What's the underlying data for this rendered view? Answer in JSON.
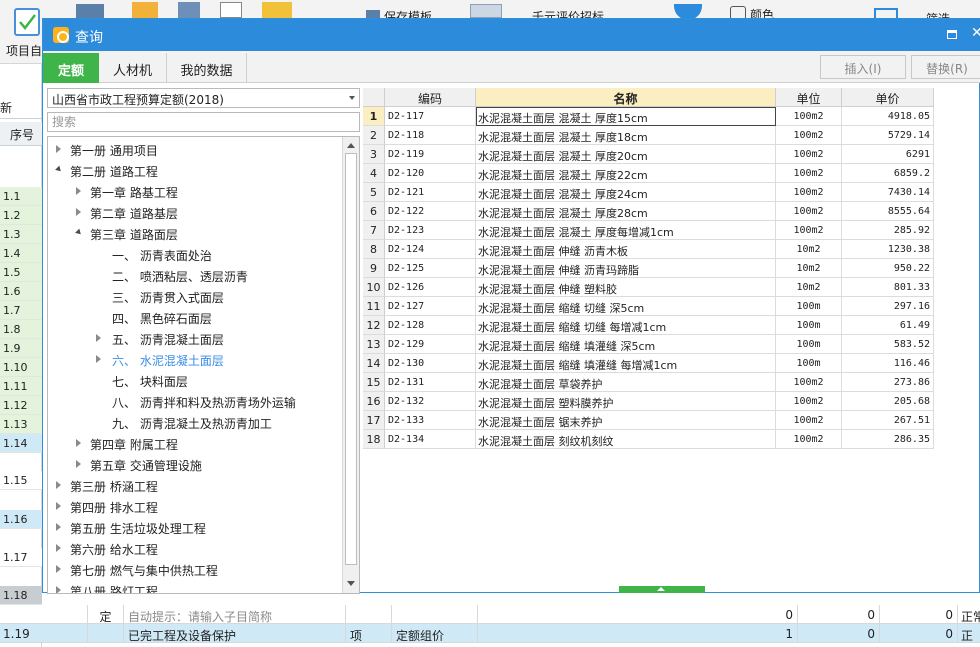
{
  "background": {
    "toolbar": {
      "project_label": "项目自",
      "partial_labels": [
        "保存模板",
        "千元评价招标",
        "颜色",
        "筛选"
      ]
    },
    "left_tab_fragment": "新",
    "column_header": "序号",
    "row_labels": [
      "1.1",
      "1.2",
      "1.3",
      "1.4",
      "1.5",
      "1.6",
      "1.7",
      "1.8",
      "1.9",
      "1.10",
      "1.11",
      "1.12",
      "1.13",
      "1.14",
      "1.15",
      "1.16",
      "1.17",
      "1.18"
    ],
    "bottom_rows": [
      {
        "no": "",
        "type": "定",
        "name": "自动提示：请输入子目简称",
        "unit": "",
        "kind": "",
        "v1": "0",
        "v2": "0",
        "v3": "0",
        "tail": "正常"
      },
      {
        "no": "1.19",
        "type": "",
        "name": "已完工程及设备保护",
        "unit": "项",
        "kind": "定额组价",
        "v1": "1",
        "v2": "0",
        "v3": "0",
        "tail": "正"
      }
    ]
  },
  "dialog": {
    "title": "查询",
    "tabs": [
      "定额",
      "人材机",
      "我的数据"
    ],
    "active_tab": "定额",
    "insert_label": "插入(I)",
    "replace_label": "替换(R)",
    "region": "山西省市政工程预算定额(2018)",
    "search_placeholder": "搜索",
    "tree": [
      {
        "label": "第一册  通用项目",
        "state": "collapsed"
      },
      {
        "label": "第二册  道路工程",
        "state": "expanded"
      },
      {
        "label": "第一章  路基工程",
        "state": "collapsed"
      },
      {
        "label": "第二章  道路基层",
        "state": "collapsed"
      },
      {
        "label": "第三章  道路面层",
        "state": "expanded"
      },
      {
        "label": "一、  沥青表面处治",
        "state": "leaf"
      },
      {
        "label": "二、  喷洒粘层、透层沥青",
        "state": "leaf"
      },
      {
        "label": "三、  沥青贯入式面层",
        "state": "leaf"
      },
      {
        "label": "四、  黑色碎石面层",
        "state": "leaf"
      },
      {
        "label": "五、  沥青混凝土面层",
        "state": "collapsed"
      },
      {
        "label": "六、  水泥混凝土面层",
        "state": "collapsed",
        "selected": true
      },
      {
        "label": "七、  块料面层",
        "state": "leaf"
      },
      {
        "label": "八、  沥青拌和料及热沥青场外运输",
        "state": "leaf"
      },
      {
        "label": "九、  沥青混凝土及热沥青加工",
        "state": "leaf"
      },
      {
        "label": "第四章  附属工程",
        "state": "collapsed"
      },
      {
        "label": "第五章  交通管理设施",
        "state": "collapsed"
      },
      {
        "label": "第三册  桥涵工程",
        "state": "collapsed"
      },
      {
        "label": "第四册  排水工程",
        "state": "collapsed"
      },
      {
        "label": "第五册  生活垃圾处理工程",
        "state": "collapsed"
      },
      {
        "label": "第六册  给水工程",
        "state": "collapsed"
      },
      {
        "label": "第七册  燃气与集中供热工程",
        "state": "collapsed"
      },
      {
        "label": "第八册  路灯工程",
        "state": "collapsed"
      }
    ],
    "table": {
      "columns": [
        "",
        "编码",
        "名称",
        "单位",
        "单价"
      ],
      "rows": [
        {
          "no": "1",
          "code": "D2-117",
          "name": "水泥混凝土面层 混凝土 厚度15cm",
          "unit": "100m2",
          "price": "4918.05"
        },
        {
          "no": "2",
          "code": "D2-118",
          "name": "水泥混凝土面层 混凝土 厚度18cm",
          "unit": "100m2",
          "price": "5729.14"
        },
        {
          "no": "3",
          "code": "D2-119",
          "name": "水泥混凝土面层 混凝土 厚度20cm",
          "unit": "100m2",
          "price": "6291"
        },
        {
          "no": "4",
          "code": "D2-120",
          "name": "水泥混凝土面层 混凝土 厚度22cm",
          "unit": "100m2",
          "price": "6859.2"
        },
        {
          "no": "5",
          "code": "D2-121",
          "name": "水泥混凝土面层 混凝土 厚度24cm",
          "unit": "100m2",
          "price": "7430.14"
        },
        {
          "no": "6",
          "code": "D2-122",
          "name": "水泥混凝土面层 混凝土 厚度28cm",
          "unit": "100m2",
          "price": "8555.64"
        },
        {
          "no": "7",
          "code": "D2-123",
          "name": "水泥混凝土面层 混凝土 厚度每增减1cm",
          "unit": "100m2",
          "price": "285.92"
        },
        {
          "no": "8",
          "code": "D2-124",
          "name": "水泥混凝土面层 伸缝 沥青木板",
          "unit": "10m2",
          "price": "1230.38"
        },
        {
          "no": "9",
          "code": "D2-125",
          "name": "水泥混凝土面层 伸缝 沥青玛蹄脂",
          "unit": "10m2",
          "price": "950.22"
        },
        {
          "no": "10",
          "code": "D2-126",
          "name": "水泥混凝土面层 伸缝 塑料胶",
          "unit": "10m2",
          "price": "801.33"
        },
        {
          "no": "11",
          "code": "D2-127",
          "name": "水泥混凝土面层 缩缝 切缝 深5cm",
          "unit": "100m",
          "price": "297.16"
        },
        {
          "no": "12",
          "code": "D2-128",
          "name": "水泥混凝土面层 缩缝 切缝 每增减1cm",
          "unit": "100m",
          "price": "61.49"
        },
        {
          "no": "13",
          "code": "D2-129",
          "name": "水泥混凝土面层 缩缝 填灌缝 深5cm",
          "unit": "100m",
          "price": "583.52"
        },
        {
          "no": "14",
          "code": "D2-130",
          "name": "水泥混凝土面层 缩缝 填灌缝 每增减1cm",
          "unit": "100m",
          "price": "116.46"
        },
        {
          "no": "15",
          "code": "D2-131",
          "name": "水泥混凝土面层 草袋养护",
          "unit": "100m2",
          "price": "273.86"
        },
        {
          "no": "16",
          "code": "D2-132",
          "name": "水泥混凝土面层 塑料膜养护",
          "unit": "100m2",
          "price": "205.68"
        },
        {
          "no": "17",
          "code": "D2-133",
          "name": "水泥混凝土面层 锯末养护",
          "unit": "100m2",
          "price": "267.51"
        },
        {
          "no": "18",
          "code": "D2-134",
          "name": "水泥混凝土面层 刻纹机刻纹",
          "unit": "100m2",
          "price": "286.35"
        }
      ]
    }
  },
  "colors": {
    "title_bar": "#2d8bdb",
    "active_tab": "#3eb449",
    "selected_node": "#3a8ee6",
    "header_highlight": "#fbeec0"
  }
}
